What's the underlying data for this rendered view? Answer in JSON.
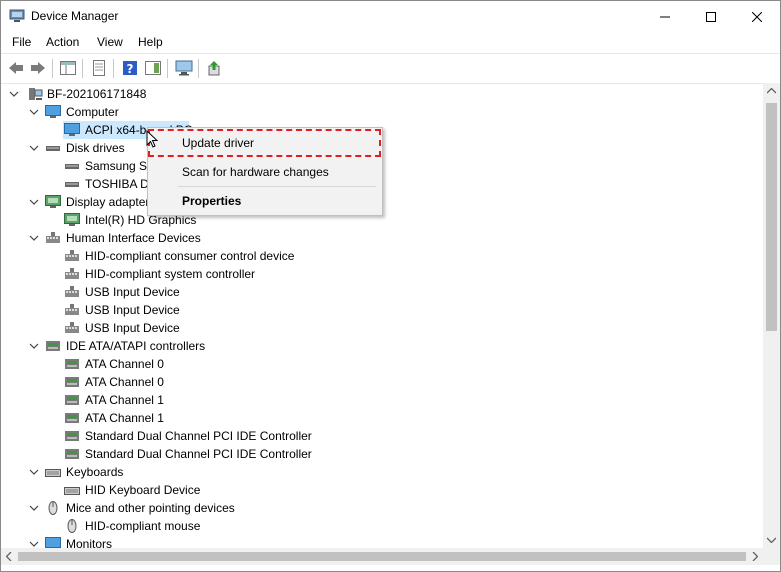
{
  "window": {
    "title": "Device Manager"
  },
  "menu": [
    "File",
    "Action",
    "View",
    "Help"
  ],
  "tree": {
    "root": "BF-202106171848",
    "categories": [
      {
        "label": "Computer",
        "icon": "computer-icon",
        "children": [
          "ACPI x64-based PC"
        ]
      },
      {
        "label": "Disk drives",
        "icon": "disk-drive-icon",
        "children": [
          "Samsung SS",
          "TOSHIBA DT"
        ]
      },
      {
        "label": "Display adapter",
        "icon": "display-adapter-icon",
        "children": [
          "Intel(R) HD Graphics"
        ]
      },
      {
        "label": "Human Interface Devices",
        "icon": "hid-icon",
        "children": [
          "HID-compliant consumer control device",
          "HID-compliant system controller",
          "USB Input Device",
          "USB Input Device",
          "USB Input Device"
        ]
      },
      {
        "label": "IDE ATA/ATAPI controllers",
        "icon": "ide-controller-icon",
        "children": [
          "ATA Channel 0",
          "ATA Channel 0",
          "ATA Channel 1",
          "ATA Channel 1",
          "Standard Dual Channel PCI IDE Controller",
          "Standard Dual Channel PCI IDE Controller"
        ]
      },
      {
        "label": "Keyboards",
        "icon": "keyboard-icon",
        "children": [
          "HID Keyboard Device"
        ]
      },
      {
        "label": "Mice and other pointing devices",
        "icon": "mouse-icon",
        "children": [
          "HID-compliant mouse"
        ]
      },
      {
        "label": "Monitors",
        "icon": "monitor-icon",
        "children": []
      }
    ]
  },
  "context_menu": {
    "update_driver": "Update driver",
    "scan": "Scan for hardware changes",
    "properties": "Properties"
  },
  "colors": {
    "selection": "#cce8ff",
    "highlight_border": "#e02020",
    "context_bg": "#f2f2f2"
  }
}
